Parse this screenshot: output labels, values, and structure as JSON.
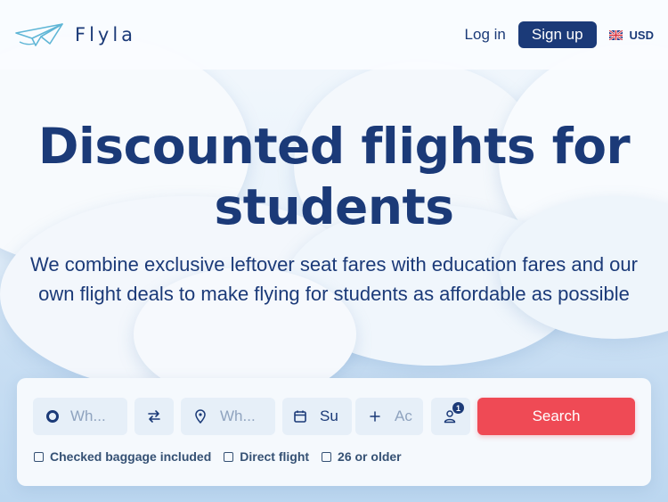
{
  "header": {
    "brand_name": "Flyla",
    "login_label": "Log in",
    "signup_label": "Sign up",
    "currency": "USD"
  },
  "hero": {
    "title_line1": "Discounted flights for",
    "title_line2": "students",
    "subtitle": "We combine exclusive leftover seat fares with education fares and our own flight deals to make flying for students as affordable as possible"
  },
  "search": {
    "from_placeholder": "Wh...",
    "to_placeholder": "Wh...",
    "date_value": "Su",
    "return_placeholder": "Ac",
    "passengers_count": "1",
    "search_label": "Search",
    "options": [
      {
        "label": "Checked baggage included"
      },
      {
        "label": "Direct flight"
      },
      {
        "label": "26 or older"
      }
    ]
  },
  "colors": {
    "primary": "#1b3a78",
    "accent": "#ef4a55",
    "field_bg": "#e6eff8"
  },
  "icons": {
    "logo": "paper-plane-icon",
    "flag": "uk-flag-icon",
    "origin": "circle-icon",
    "swap": "swap-arrows-icon",
    "destination": "map-pin-icon",
    "date": "calendar-icon",
    "return": "plus-icon",
    "passengers": "user-icon"
  }
}
